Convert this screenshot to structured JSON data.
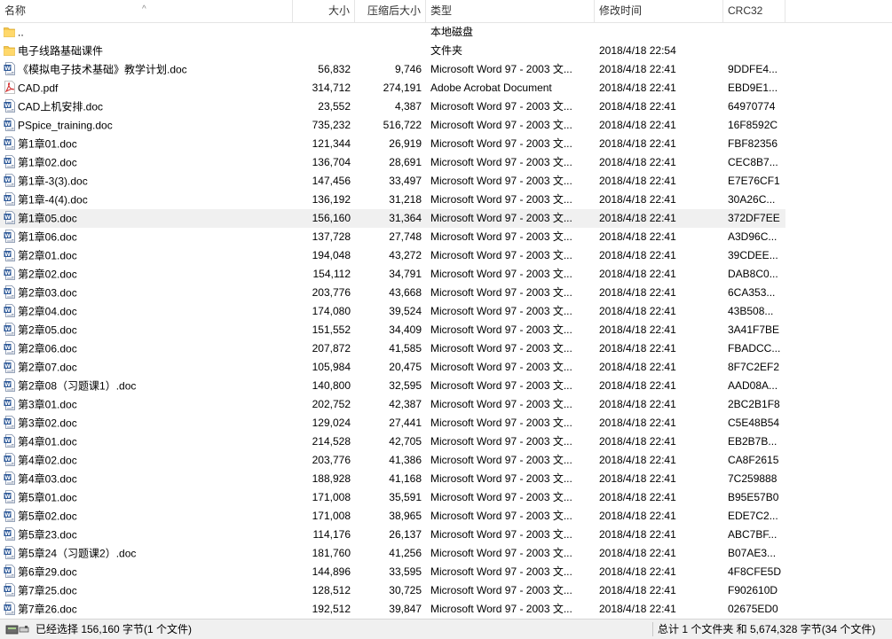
{
  "columns": {
    "name": "名称",
    "size": "大小",
    "packed": "压缩后大小",
    "type": "类型",
    "modified": "修改时间",
    "crc": "CRC32"
  },
  "rows": [
    {
      "name": "..",
      "size": "",
      "packed": "",
      "type": "本地磁盘",
      "modified": "",
      "crc": "",
      "icon": "folder-icon"
    },
    {
      "name": "电子线路基础课件",
      "size": "",
      "packed": "",
      "type": "文件夹",
      "modified": "2018/4/18 22:54",
      "crc": "",
      "icon": "folder-icon"
    },
    {
      "name": "《模拟电子技术基础》教学计划.doc",
      "size": "56,832",
      "packed": "9,746",
      "type": "Microsoft Word 97 - 2003 文...",
      "modified": "2018/4/18 22:41",
      "crc": "9DDFE4...",
      "icon": "word-doc-icon"
    },
    {
      "name": "CAD.pdf",
      "size": "314,712",
      "packed": "274,191",
      "type": "Adobe Acrobat Document",
      "modified": "2018/4/18 22:41",
      "crc": "EBD9E1...",
      "icon": "pdf-icon"
    },
    {
      "name": "CAD上机安排.doc",
      "size": "23,552",
      "packed": "4,387",
      "type": "Microsoft Word 97 - 2003 文...",
      "modified": "2018/4/18 22:41",
      "crc": "64970774",
      "icon": "word-doc-icon"
    },
    {
      "name": "PSpice_training.doc",
      "size": "735,232",
      "packed": "516,722",
      "type": "Microsoft Word 97 - 2003 文...",
      "modified": "2018/4/18 22:41",
      "crc": "16F8592C",
      "icon": "word-doc-icon"
    },
    {
      "name": "第1章01.doc",
      "size": "121,344",
      "packed": "26,919",
      "type": "Microsoft Word 97 - 2003 文...",
      "modified": "2018/4/18 22:41",
      "crc": "FBF82356",
      "icon": "word-doc-icon"
    },
    {
      "name": "第1章02.doc",
      "size": "136,704",
      "packed": "28,691",
      "type": "Microsoft Word 97 - 2003 文...",
      "modified": "2018/4/18 22:41",
      "crc": "CEC8B7...",
      "icon": "word-doc-icon"
    },
    {
      "name": "第1章-3(3).doc",
      "size": "147,456",
      "packed": "33,497",
      "type": "Microsoft Word 97 - 2003 文...",
      "modified": "2018/4/18 22:41",
      "crc": "E7E76CF1",
      "icon": "word-doc-icon"
    },
    {
      "name": "第1章-4(4).doc",
      "size": "136,192",
      "packed": "31,218",
      "type": "Microsoft Word 97 - 2003 文...",
      "modified": "2018/4/18 22:41",
      "crc": "30A26C...",
      "icon": "word-doc-icon"
    },
    {
      "name": "第1章05.doc",
      "size": "156,160",
      "packed": "31,364",
      "type": "Microsoft Word 97 - 2003 文...",
      "modified": "2018/4/18 22:41",
      "crc": "372DF7EE",
      "icon": "word-doc-icon",
      "selected": true
    },
    {
      "name": "第1章06.doc",
      "size": "137,728",
      "packed": "27,748",
      "type": "Microsoft Word 97 - 2003 文...",
      "modified": "2018/4/18 22:41",
      "crc": "A3D96C...",
      "icon": "word-doc-icon"
    },
    {
      "name": "第2章01.doc",
      "size": "194,048",
      "packed": "43,272",
      "type": "Microsoft Word 97 - 2003 文...",
      "modified": "2018/4/18 22:41",
      "crc": "39CDEE...",
      "icon": "word-doc-icon"
    },
    {
      "name": "第2章02.doc",
      "size": "154,112",
      "packed": "34,791",
      "type": "Microsoft Word 97 - 2003 文...",
      "modified": "2018/4/18 22:41",
      "crc": "DAB8C0...",
      "icon": "word-doc-icon"
    },
    {
      "name": "第2章03.doc",
      "size": "203,776",
      "packed": "43,668",
      "type": "Microsoft Word 97 - 2003 文...",
      "modified": "2018/4/18 22:41",
      "crc": "6CA353...",
      "icon": "word-doc-icon"
    },
    {
      "name": "第2章04.doc",
      "size": "174,080",
      "packed": "39,524",
      "type": "Microsoft Word 97 - 2003 文...",
      "modified": "2018/4/18 22:41",
      "crc": "43B508...",
      "icon": "word-doc-icon"
    },
    {
      "name": "第2章05.doc",
      "size": "151,552",
      "packed": "34,409",
      "type": "Microsoft Word 97 - 2003 文...",
      "modified": "2018/4/18 22:41",
      "crc": "3A41F7BE",
      "icon": "word-doc-icon"
    },
    {
      "name": "第2章06.doc",
      "size": "207,872",
      "packed": "41,585",
      "type": "Microsoft Word 97 - 2003 文...",
      "modified": "2018/4/18 22:41",
      "crc": "FBADCC...",
      "icon": "word-doc-icon"
    },
    {
      "name": "第2章07.doc",
      "size": "105,984",
      "packed": "20,475",
      "type": "Microsoft Word 97 - 2003 文...",
      "modified": "2018/4/18 22:41",
      "crc": "8F7C2EF2",
      "icon": "word-doc-icon"
    },
    {
      "name": "第2章08（习题课1）.doc",
      "size": "140,800",
      "packed": "32,595",
      "type": "Microsoft Word 97 - 2003 文...",
      "modified": "2018/4/18 22:41",
      "crc": "AAD08A...",
      "icon": "word-doc-icon"
    },
    {
      "name": "第3章01.doc",
      "size": "202,752",
      "packed": "42,387",
      "type": "Microsoft Word 97 - 2003 文...",
      "modified": "2018/4/18 22:41",
      "crc": "2BC2B1F8",
      "icon": "word-doc-icon"
    },
    {
      "name": "第3章02.doc",
      "size": "129,024",
      "packed": "27,441",
      "type": "Microsoft Word 97 - 2003 文...",
      "modified": "2018/4/18 22:41",
      "crc": "C5E48B54",
      "icon": "word-doc-icon"
    },
    {
      "name": "第4章01.doc",
      "size": "214,528",
      "packed": "42,705",
      "type": "Microsoft Word 97 - 2003 文...",
      "modified": "2018/4/18 22:41",
      "crc": "EB2B7B...",
      "icon": "word-doc-icon"
    },
    {
      "name": "第4章02.doc",
      "size": "203,776",
      "packed": "41,386",
      "type": "Microsoft Word 97 - 2003 文...",
      "modified": "2018/4/18 22:41",
      "crc": "CA8F2615",
      "icon": "word-doc-icon"
    },
    {
      "name": "第4章03.doc",
      "size": "188,928",
      "packed": "41,168",
      "type": "Microsoft Word 97 - 2003 文...",
      "modified": "2018/4/18 22:41",
      "crc": "7C259888",
      "icon": "word-doc-icon"
    },
    {
      "name": "第5章01.doc",
      "size": "171,008",
      "packed": "35,591",
      "type": "Microsoft Word 97 - 2003 文...",
      "modified": "2018/4/18 22:41",
      "crc": "B95E57B0",
      "icon": "word-doc-icon"
    },
    {
      "name": "第5章02.doc",
      "size": "171,008",
      "packed": "38,965",
      "type": "Microsoft Word 97 - 2003 文...",
      "modified": "2018/4/18 22:41",
      "crc": "EDE7C2...",
      "icon": "word-doc-icon"
    },
    {
      "name": "第5章23.doc",
      "size": "114,176",
      "packed": "26,137",
      "type": "Microsoft Word 97 - 2003 文...",
      "modified": "2018/4/18 22:41",
      "crc": "ABC7BF...",
      "icon": "word-doc-icon"
    },
    {
      "name": "第5章24（习题课2）.doc",
      "size": "181,760",
      "packed": "41,256",
      "type": "Microsoft Word 97 - 2003 文...",
      "modified": "2018/4/18 22:41",
      "crc": "B07AE3...",
      "icon": "word-doc-icon"
    },
    {
      "name": "第6章29.doc",
      "size": "144,896",
      "packed": "33,595",
      "type": "Microsoft Word 97 - 2003 文...",
      "modified": "2018/4/18 22:41",
      "crc": "4F8CFE5D",
      "icon": "word-doc-icon"
    },
    {
      "name": "第7章25.doc",
      "size": "128,512",
      "packed": "30,725",
      "type": "Microsoft Word 97 - 2003 文...",
      "modified": "2018/4/18 22:41",
      "crc": "F902610D",
      "icon": "word-doc-icon"
    },
    {
      "name": "第7章26.doc",
      "size": "192,512",
      "packed": "39,847",
      "type": "Microsoft Word 97 - 2003 文...",
      "modified": "2018/4/18 22:41",
      "crc": "02675ED0",
      "icon": "word-doc-icon"
    }
  ],
  "status": {
    "selected": "已经选择 156,160 字节(1 个文件)",
    "total": "总计 1 个文件夹 和 5,674,328 字节(34 个文件)",
    "icon": "drive-status-icon"
  },
  "colors": {
    "selected_row": "#f0f0f0",
    "folder": "#f4c74f",
    "word_blue": "#2b5797",
    "pdf_red": "#d32f2f"
  }
}
